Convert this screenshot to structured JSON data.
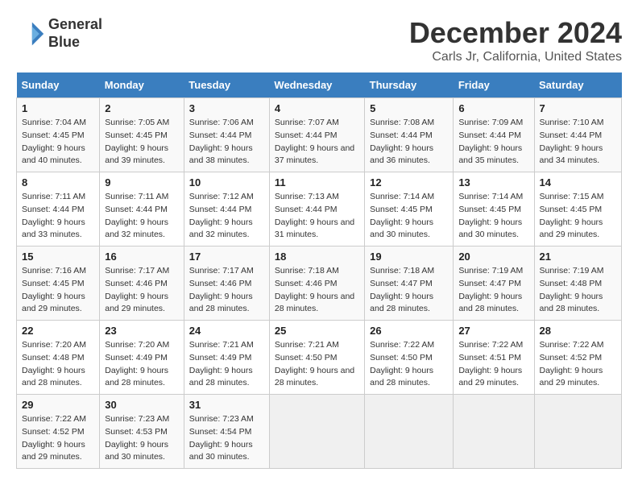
{
  "header": {
    "logo_line1": "General",
    "logo_line2": "Blue",
    "title": "December 2024",
    "subtitle": "Carls Jr, California, United States"
  },
  "weekdays": [
    "Sunday",
    "Monday",
    "Tuesday",
    "Wednesday",
    "Thursday",
    "Friday",
    "Saturday"
  ],
  "weeks": [
    [
      {
        "day": "1",
        "sunrise": "Sunrise: 7:04 AM",
        "sunset": "Sunset: 4:45 PM",
        "daylight": "Daylight: 9 hours and 40 minutes."
      },
      {
        "day": "2",
        "sunrise": "Sunrise: 7:05 AM",
        "sunset": "Sunset: 4:45 PM",
        "daylight": "Daylight: 9 hours and 39 minutes."
      },
      {
        "day": "3",
        "sunrise": "Sunrise: 7:06 AM",
        "sunset": "Sunset: 4:44 PM",
        "daylight": "Daylight: 9 hours and 38 minutes."
      },
      {
        "day": "4",
        "sunrise": "Sunrise: 7:07 AM",
        "sunset": "Sunset: 4:44 PM",
        "daylight": "Daylight: 9 hours and 37 minutes."
      },
      {
        "day": "5",
        "sunrise": "Sunrise: 7:08 AM",
        "sunset": "Sunset: 4:44 PM",
        "daylight": "Daylight: 9 hours and 36 minutes."
      },
      {
        "day": "6",
        "sunrise": "Sunrise: 7:09 AM",
        "sunset": "Sunset: 4:44 PM",
        "daylight": "Daylight: 9 hours and 35 minutes."
      },
      {
        "day": "7",
        "sunrise": "Sunrise: 7:10 AM",
        "sunset": "Sunset: 4:44 PM",
        "daylight": "Daylight: 9 hours and 34 minutes."
      }
    ],
    [
      {
        "day": "8",
        "sunrise": "Sunrise: 7:11 AM",
        "sunset": "Sunset: 4:44 PM",
        "daylight": "Daylight: 9 hours and 33 minutes."
      },
      {
        "day": "9",
        "sunrise": "Sunrise: 7:11 AM",
        "sunset": "Sunset: 4:44 PM",
        "daylight": "Daylight: 9 hours and 32 minutes."
      },
      {
        "day": "10",
        "sunrise": "Sunrise: 7:12 AM",
        "sunset": "Sunset: 4:44 PM",
        "daylight": "Daylight: 9 hours and 32 minutes."
      },
      {
        "day": "11",
        "sunrise": "Sunrise: 7:13 AM",
        "sunset": "Sunset: 4:44 PM",
        "daylight": "Daylight: 9 hours and 31 minutes."
      },
      {
        "day": "12",
        "sunrise": "Sunrise: 7:14 AM",
        "sunset": "Sunset: 4:45 PM",
        "daylight": "Daylight: 9 hours and 30 minutes."
      },
      {
        "day": "13",
        "sunrise": "Sunrise: 7:14 AM",
        "sunset": "Sunset: 4:45 PM",
        "daylight": "Daylight: 9 hours and 30 minutes."
      },
      {
        "day": "14",
        "sunrise": "Sunrise: 7:15 AM",
        "sunset": "Sunset: 4:45 PM",
        "daylight": "Daylight: 9 hours and 29 minutes."
      }
    ],
    [
      {
        "day": "15",
        "sunrise": "Sunrise: 7:16 AM",
        "sunset": "Sunset: 4:45 PM",
        "daylight": "Daylight: 9 hours and 29 minutes."
      },
      {
        "day": "16",
        "sunrise": "Sunrise: 7:17 AM",
        "sunset": "Sunset: 4:46 PM",
        "daylight": "Daylight: 9 hours and 29 minutes."
      },
      {
        "day": "17",
        "sunrise": "Sunrise: 7:17 AM",
        "sunset": "Sunset: 4:46 PM",
        "daylight": "Daylight: 9 hours and 28 minutes."
      },
      {
        "day": "18",
        "sunrise": "Sunrise: 7:18 AM",
        "sunset": "Sunset: 4:46 PM",
        "daylight": "Daylight: 9 hours and 28 minutes."
      },
      {
        "day": "19",
        "sunrise": "Sunrise: 7:18 AM",
        "sunset": "Sunset: 4:47 PM",
        "daylight": "Daylight: 9 hours and 28 minutes."
      },
      {
        "day": "20",
        "sunrise": "Sunrise: 7:19 AM",
        "sunset": "Sunset: 4:47 PM",
        "daylight": "Daylight: 9 hours and 28 minutes."
      },
      {
        "day": "21",
        "sunrise": "Sunrise: 7:19 AM",
        "sunset": "Sunset: 4:48 PM",
        "daylight": "Daylight: 9 hours and 28 minutes."
      }
    ],
    [
      {
        "day": "22",
        "sunrise": "Sunrise: 7:20 AM",
        "sunset": "Sunset: 4:48 PM",
        "daylight": "Daylight: 9 hours and 28 minutes."
      },
      {
        "day": "23",
        "sunrise": "Sunrise: 7:20 AM",
        "sunset": "Sunset: 4:49 PM",
        "daylight": "Daylight: 9 hours and 28 minutes."
      },
      {
        "day": "24",
        "sunrise": "Sunrise: 7:21 AM",
        "sunset": "Sunset: 4:49 PM",
        "daylight": "Daylight: 9 hours and 28 minutes."
      },
      {
        "day": "25",
        "sunrise": "Sunrise: 7:21 AM",
        "sunset": "Sunset: 4:50 PM",
        "daylight": "Daylight: 9 hours and 28 minutes."
      },
      {
        "day": "26",
        "sunrise": "Sunrise: 7:22 AM",
        "sunset": "Sunset: 4:50 PM",
        "daylight": "Daylight: 9 hours and 28 minutes."
      },
      {
        "day": "27",
        "sunrise": "Sunrise: 7:22 AM",
        "sunset": "Sunset: 4:51 PM",
        "daylight": "Daylight: 9 hours and 29 minutes."
      },
      {
        "day": "28",
        "sunrise": "Sunrise: 7:22 AM",
        "sunset": "Sunset: 4:52 PM",
        "daylight": "Daylight: 9 hours and 29 minutes."
      }
    ],
    [
      {
        "day": "29",
        "sunrise": "Sunrise: 7:22 AM",
        "sunset": "Sunset: 4:52 PM",
        "daylight": "Daylight: 9 hours and 29 minutes."
      },
      {
        "day": "30",
        "sunrise": "Sunrise: 7:23 AM",
        "sunset": "Sunset: 4:53 PM",
        "daylight": "Daylight: 9 hours and 30 minutes."
      },
      {
        "day": "31",
        "sunrise": "Sunrise: 7:23 AM",
        "sunset": "Sunset: 4:54 PM",
        "daylight": "Daylight: 9 hours and 30 minutes."
      },
      null,
      null,
      null,
      null
    ]
  ]
}
